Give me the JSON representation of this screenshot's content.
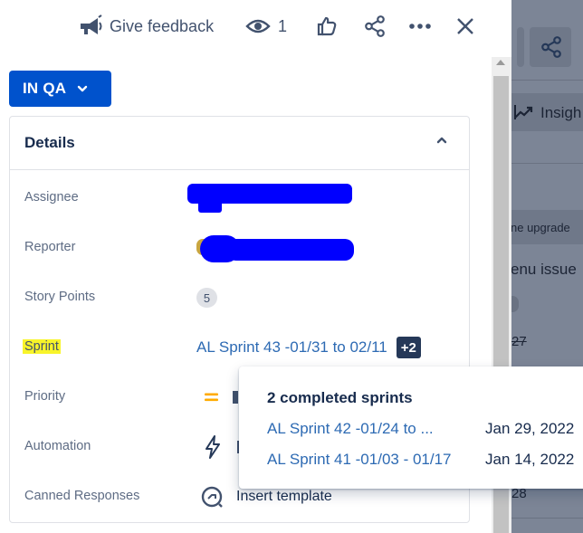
{
  "topbar": {
    "feedback_label": "Give feedback",
    "watchers_count": "1"
  },
  "status": {
    "label": "IN QA",
    "color": "#0052cc"
  },
  "details": {
    "title": "Details",
    "fields": [
      {
        "label": "Assignee"
      },
      {
        "label": "Reporter"
      },
      {
        "label": "Story Points",
        "value": "5"
      },
      {
        "label": "Sprint",
        "value": "AL Sprint 43 -01/31 to 02/11",
        "extra": "+2"
      },
      {
        "label": "Priority"
      },
      {
        "label": "Automation"
      },
      {
        "label": "Canned Responses",
        "value": "Insert template"
      }
    ]
  },
  "popover": {
    "title": "2 completed sprints",
    "sprints": [
      {
        "name": "AL Sprint 42 -01/24 to ...",
        "date": "Jan 29, 2022"
      },
      {
        "name": "AL Sprint 41 -01/03 - 01/17",
        "date": "Jan 14, 2022"
      }
    ]
  },
  "background": {
    "insights_label": "Insigh",
    "upgrade_text": "ne upgrade",
    "menu_issue_text": "enu issue",
    "num_27": "27",
    "num_28": "28"
  },
  "colors": {
    "accent": "#0052cc",
    "link": "#2d6ab3",
    "highlight": "#f8f42a",
    "priority_medium": "#ffab00"
  }
}
